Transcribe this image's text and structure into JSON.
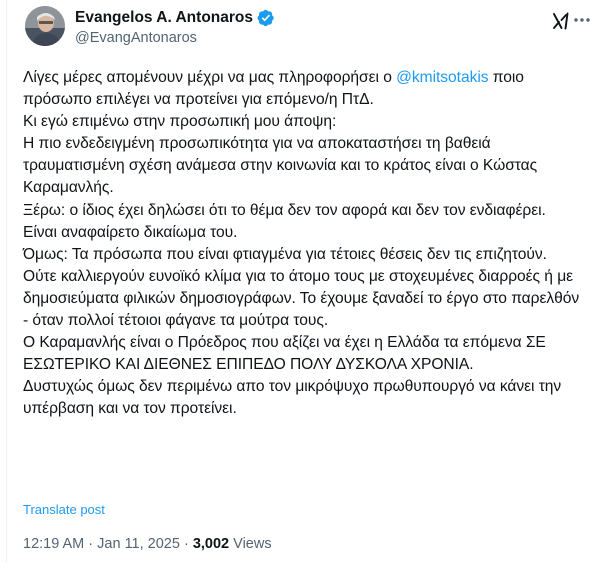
{
  "author": {
    "name": "Evangelos A. Antonaros",
    "handle": "@EvangAntonaros",
    "verified": true
  },
  "icons": {
    "avatar": "profile-photo",
    "verified": "verified-badge-icon",
    "grok": "grok-icon",
    "more": "more-options-icon"
  },
  "colors": {
    "accent": "#1d9bf0",
    "text": "#0f1419",
    "secondary": "#536471"
  },
  "tweet": {
    "line1_pre": "Λίγες μέρες απομένουν μέχρι να μας πληροφορήσει ο ",
    "mention": "@kmitsotakis",
    "line1_post": " ποιο πρόσωπο επιλέγει να προτείνει για επόμενο/η ΠτΔ.",
    "p2": "Κι εγώ επιμένω στην προσωπική μου άποψη:",
    "p3": "Η πιο ενδεδειγμένη προσωπικότητα για να αποκαταστήσει τη βαθειά τραυματισμένη σχέση ανάμεσα στην κοινωνία και το κράτος είναι ο Κώστας Καραμανλής.",
    "p4": "Ξέρω: ο ίδιος έχει δηλώσει ότι το θέμα δεν τον αφορά και δεν τον ενδιαφέρει.",
    "p5": "Είναι αναφαίρετο δικαίωμα του.",
    "p6": "Όμως: Τα πρόσωπα που είναι φτιαγμένα για τέτοιες θέσεις δεν τις επιζητούν. Ούτε καλλιεργούν ευνοϊκό κλίμα για το άτομο τους με στοχευμένες διαρροές ή με δημοσιεύματα φιλικών δημοσιογράφων. Το έχουμε ξαναδεί το έργο στο παρελθόν - όταν πολλοί τέτοιοι φάγανε τα μούτρα τους.",
    "p7": "Ο Καραμανλής είναι ο Πρόεδρος που αξίζει να έχει η Ελλάδα τα επόμενα ΣΕ ΕΣΩΤΕΡΙΚΟ ΚΑΙ ΔΙΕΘΝΕΣ ΕΠΙΠΕΔΟ ΠΟΛΥ ΔΥΣΚΟΛΑ ΧΡΟΝΙΑ.",
    "p8": "Δυστυχώς όμως δεν περιμένω απο τον μικρόψυχο πρωθυπουργό να κάνει την υπέρβαση και να τον προτείνει."
  },
  "translate_label": "Translate post",
  "meta": {
    "time": "12:19 AM",
    "separator": " · ",
    "date": "Jan 11, 2025",
    "views_count": "3,002",
    "views_label": " Views"
  }
}
